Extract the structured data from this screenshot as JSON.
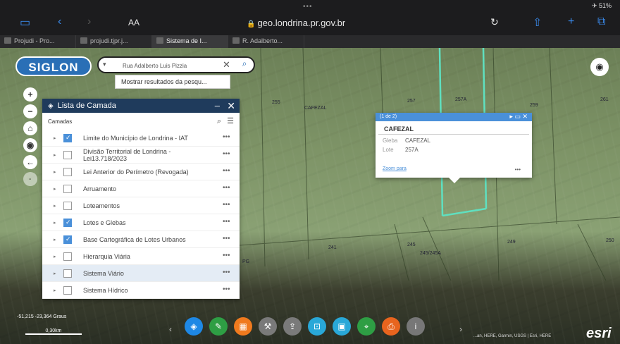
{
  "browser": {
    "status_right": "✈ 51%",
    "text_size": "AA",
    "url": "geo.londrina.pr.gov.br",
    "tabs": [
      {
        "label": "Projudi - Pro..."
      },
      {
        "label": "projudi.tjpr.j..."
      },
      {
        "label": "Sistema de I..."
      },
      {
        "label": "R. Adalberto..."
      }
    ]
  },
  "app": {
    "logo": "SIGLON",
    "search": {
      "dropdown": "▾",
      "value": "Rua Adalberto Luis Pizzia",
      "clear": "✕",
      "button": "⌕"
    },
    "suggestion": "Mostrar resultados da pesqu..."
  },
  "side_tools": [
    {
      "name": "zoom-in",
      "glyph": "+"
    },
    {
      "name": "zoom-out",
      "glyph": "−"
    },
    {
      "name": "home",
      "glyph": "⌂"
    },
    {
      "name": "locate",
      "glyph": "◉"
    },
    {
      "name": "back",
      "glyph": "←"
    },
    {
      "name": "disabled",
      "glyph": "·"
    }
  ],
  "layer_panel": {
    "title": "Lista de Camada",
    "minimize": "–",
    "close": "✕",
    "subtitle": "Camadas",
    "layers": [
      {
        "label": "Limite do Município de Londrina - IAT",
        "checked": true,
        "two_line": false,
        "highlight": false
      },
      {
        "label": "Divisão Territorial de Londrina - Lei13.718/2023",
        "checked": false,
        "two_line": true,
        "highlight": false
      },
      {
        "label": "Lei Anterior do Perímetro (Revogada)",
        "checked": false,
        "two_line": false,
        "highlight": false
      },
      {
        "label": "Arruamento",
        "checked": false,
        "two_line": false,
        "highlight": false
      },
      {
        "label": "Loteamentos",
        "checked": false,
        "two_line": false,
        "highlight": false
      },
      {
        "label": "Lotes e Glebas",
        "checked": true,
        "two_line": false,
        "highlight": false
      },
      {
        "label": "Base Cartográfica de Lotes Urbanos",
        "checked": true,
        "two_line": false,
        "highlight": false
      },
      {
        "label": "Hierarquia Viária",
        "checked": false,
        "two_line": false,
        "highlight": false
      },
      {
        "label": "Sistema Viário",
        "checked": false,
        "two_line": false,
        "highlight": true
      },
      {
        "label": "Sistema Hídrico",
        "checked": false,
        "two_line": false,
        "highlight": false
      }
    ],
    "more": "•••"
  },
  "popup": {
    "counter": "(1 de 2)",
    "controls": "▸ ▭ ✕",
    "title": "CAFEZAL",
    "rows": [
      {
        "key": "Gleba",
        "value": "CAFEZAL"
      },
      {
        "key": "Lote",
        "value": "257A"
      }
    ],
    "zoom_link": "Zoom para",
    "more": "•••"
  },
  "map_labels": [
    "255",
    "CAFEZAL",
    "257",
    "257A",
    "259",
    "261",
    "241",
    "245",
    "245/245A",
    "249",
    "250",
    "PG"
  ],
  "bottom": {
    "coords": "-51,215 -23,364 Graus",
    "scale": "0,30km",
    "attribution": "...an, HERE, Garmin, USGS | Esri, HERE",
    "brand": "esri",
    "nav_left": "‹",
    "nav_right": "›"
  },
  "toolbar": [
    {
      "name": "layers-icon",
      "glyph": "◈",
      "color": "#1e88e5"
    },
    {
      "name": "draw-icon",
      "glyph": "✎",
      "color": "#2e9e44"
    },
    {
      "name": "grid-icon",
      "glyph": "▦",
      "color": "#f07a1e"
    },
    {
      "name": "tool-icon",
      "glyph": "⚒",
      "color": "#7a7a7a"
    },
    {
      "name": "share-icon",
      "glyph": "⇪",
      "color": "#7a7a7a"
    },
    {
      "name": "frame-icon",
      "glyph": "⊡",
      "color": "#29a8d8"
    },
    {
      "name": "print-map-icon",
      "glyph": "▣",
      "color": "#29a8d8"
    },
    {
      "name": "locate-icon",
      "glyph": "⌖",
      "color": "#2e9e44"
    },
    {
      "name": "printer-icon",
      "glyph": "⎙",
      "color": "#e8641e"
    },
    {
      "name": "info-icon",
      "glyph": "i",
      "color": "#777777"
    }
  ]
}
